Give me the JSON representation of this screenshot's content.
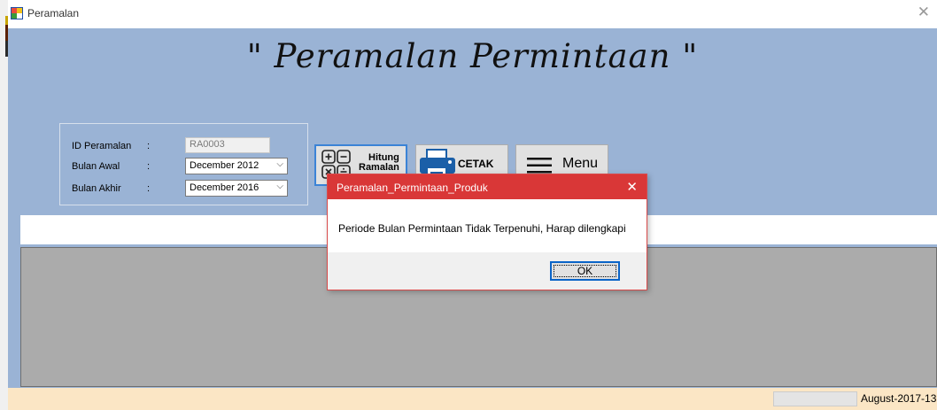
{
  "window": {
    "title": "Peramalan",
    "close_glyph": "✕"
  },
  "form": {
    "heading": "\" Peramalan Permintaan \"",
    "fields": [
      {
        "label": "ID Peramalan",
        "colon": ":",
        "value": "RA0003"
      },
      {
        "label": "Bulan Awal",
        "colon": ":",
        "value": "December 2012"
      },
      {
        "label": "Bulan Akhir",
        "colon": ":",
        "value": "December 2016"
      }
    ],
    "buttons": {
      "hitung_line1": "Hitung",
      "hitung_line2": "Ramalan",
      "cetak": "CETAK",
      "menu": "Menu"
    }
  },
  "status": {
    "date": "August-2017-13"
  },
  "dialog": {
    "title": "Peramalan_Permintaan_Produk",
    "message": "Periode Bulan Permintaan Tidak Terpenuhi, Harap dilengkapi",
    "ok": "OK",
    "close_glyph": "✕"
  },
  "icons": [
    "app-icon",
    "close-icon",
    "calculator-icon",
    "printer-icon",
    "hamburger-icon",
    "chevron-down-icon"
  ],
  "colors": {
    "form_bg": "#9ab3d5",
    "grid_bg": "#ababab",
    "status_bg": "#fbe6c5",
    "dialog_title": "#d93737",
    "focus": "#3b83d6"
  }
}
